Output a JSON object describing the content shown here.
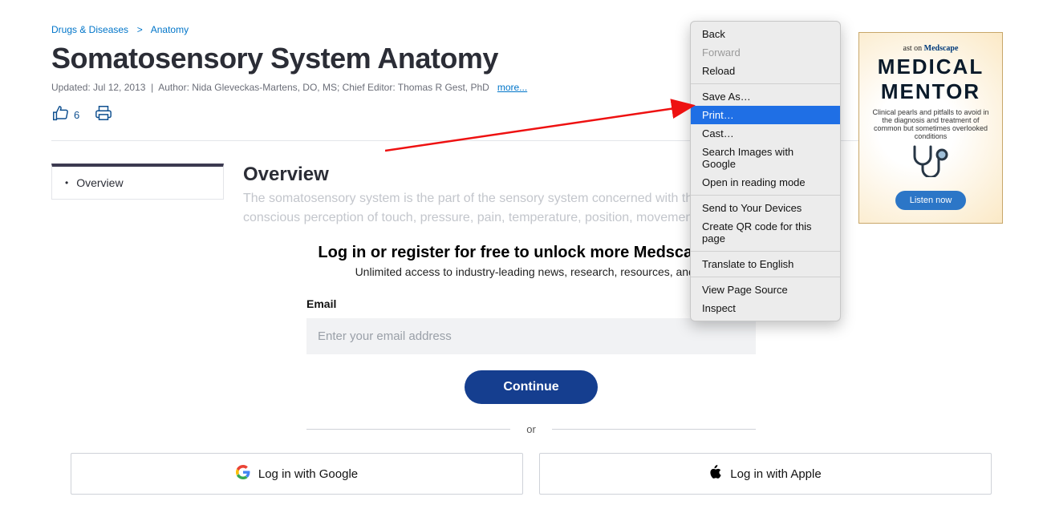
{
  "breadcrumb": {
    "root": "Drugs & Diseases",
    "leaf": "Anatomy"
  },
  "title": "Somatosensory System Anatomy",
  "meta": {
    "updated": "Updated: Jul 12, 2013",
    "sep": "|",
    "author": "Author: Nida Gleveckas-Martens, DO, MS; Chief Editor: Thomas R Gest, PhD",
    "more": "more..."
  },
  "likes": "6",
  "sidenav": {
    "item0": "Overview"
  },
  "content": {
    "heading": "Overview",
    "preview": "The somatosensory system is the part of the sensory system concerned with the conscious perception of touch, pressure, pain, temperature, position, movemen"
  },
  "login": {
    "headline": "Log in or register for free to unlock more Medscape con",
    "sub": "Unlimited access to industry-leading news, research, resources, and m",
    "email_label": "Email",
    "email_placeholder": "Enter your email address",
    "continue": "Continue",
    "or": "or",
    "google": "Log in with Google",
    "apple": "Log in with Apple"
  },
  "ad": {
    "top_prefix": "ast on ",
    "brand": "Medscape",
    "headline1": "MEDICAL",
    "headline2": "MENTOR",
    "desc": "Clinical pearls and pitfalls to avoid in the diagnosis and treatment of common but sometimes overlooked conditions",
    "cta": "Listen now"
  },
  "context_menu": {
    "back": "Back",
    "forward": "Forward",
    "reload": "Reload",
    "save_as": "Save As…",
    "print": "Print…",
    "cast": "Cast…",
    "search_images": "Search Images with Google",
    "reading_mode": "Open in reading mode",
    "send_devices": "Send to Your Devices",
    "qr": "Create QR code for this page",
    "translate": "Translate to English",
    "view_source": "View Page Source",
    "inspect": "Inspect"
  }
}
